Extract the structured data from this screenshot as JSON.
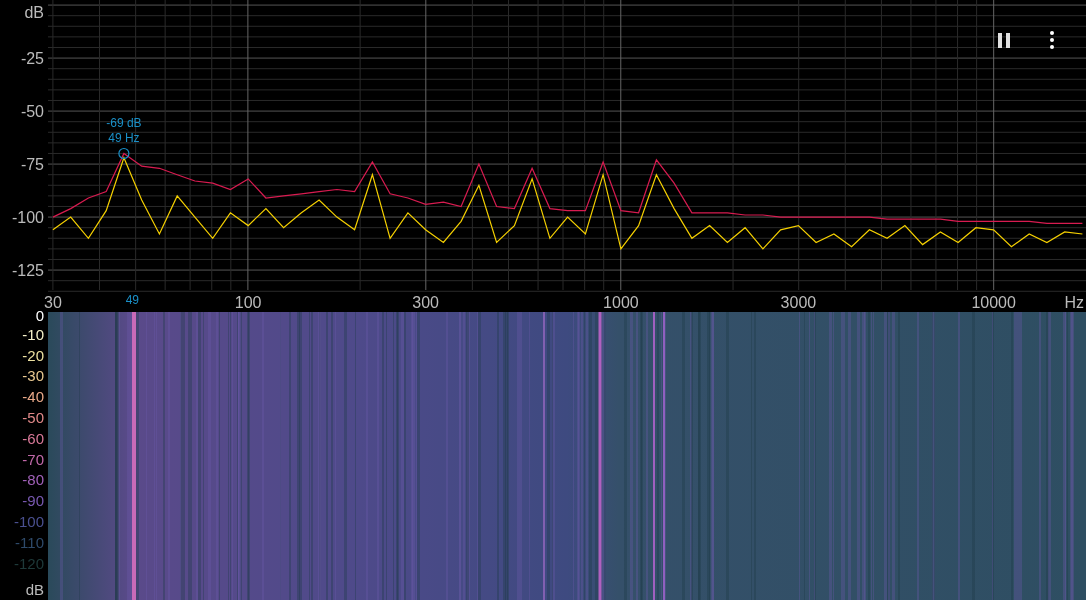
{
  "spectrum": {
    "chart_data": {
      "type": "line",
      "xlabel": "Hz",
      "ylabel": "dB",
      "grid": true,
      "ylim": [
        -134.4,
        2.4
      ],
      "yticks": [
        -25,
        -50,
        -75,
        -100,
        -125
      ],
      "categories": [
        "30",
        null,
        null,
        null,
        null,
        null,
        null,
        null,
        null,
        null,
        null,
        "100",
        null,
        null,
        null,
        null,
        null,
        null,
        null,
        null,
        null,
        "300",
        null,
        null,
        null,
        null,
        null,
        null,
        null,
        null,
        null,
        null,
        "1000",
        null,
        null,
        null,
        null,
        null,
        null,
        null,
        null,
        null,
        "3000",
        null,
        null,
        null,
        null,
        null,
        null,
        null,
        null,
        null,
        null,
        "10000",
        null,
        null,
        null,
        null,
        null
      ],
      "series": [
        {
          "color": "#f5d000",
          "values": [
            -106,
            -100,
            -110,
            -97,
            -72,
            -92,
            -108,
            -90,
            -100,
            -110,
            -98,
            -104,
            -96,
            -105,
            -98,
            -92,
            -100,
            -106,
            -80,
            -110,
            -98,
            -106,
            -112,
            -102,
            -85,
            -112,
            -104,
            -82,
            -110,
            -100,
            -108,
            -80,
            -115,
            -104,
            -80,
            -96,
            -110,
            -104,
            -112,
            -105,
            -115,
            -106,
            -104,
            -112,
            -108,
            -114,
            -106,
            -110,
            -104,
            -113,
            -107,
            -112,
            -105,
            -106,
            -114,
            -108,
            -112,
            -107,
            -108
          ]
        },
        {
          "color": "#d81b50",
          "values": [
            -100,
            -96,
            -91,
            -88,
            -70,
            -76,
            -77,
            -80,
            -83,
            -84,
            -87,
            -82,
            -91,
            -90,
            -89,
            -88,
            -87,
            -88,
            -74,
            -89,
            -91,
            -94,
            -93,
            -95,
            -75,
            -95,
            -96,
            -77,
            -96,
            -97,
            -97,
            -74,
            -97,
            -98,
            -73,
            -84,
            -98,
            -98,
            -98,
            -99,
            -99,
            -100,
            -100,
            -100,
            -100,
            -100,
            -100,
            -101,
            -101,
            -101,
            -101,
            -102,
            -102,
            -102,
            -102,
            -102,
            -103,
            -103,
            -103
          ]
        }
      ]
    },
    "peak_marker": {
      "level_text": "-69 dB",
      "frequency_text": "49 Hz",
      "axis_label": "49"
    }
  },
  "spectrogram": {
    "scale": [
      {
        "label": "0",
        "color": "#ffffff"
      },
      {
        "label": "-10",
        "color": "#f4f0c8"
      },
      {
        "label": "-20",
        "color": "#ece0a0"
      },
      {
        "label": "-30",
        "color": "#e8c890"
      },
      {
        "label": "-40",
        "color": "#e8a888"
      },
      {
        "label": "-50",
        "color": "#e08888"
      },
      {
        "label": "-60",
        "color": "#d87898"
      },
      {
        "label": "-70",
        "color": "#c068a8"
      },
      {
        "label": "-80",
        "color": "#a060b8"
      },
      {
        "label": "-90",
        "color": "#7858b0"
      },
      {
        "label": "-100",
        "color": "#4a5090"
      },
      {
        "label": "-110",
        "color": "#2e4a6a"
      },
      {
        "label": "-120",
        "color": "#1e3a3a"
      }
    ],
    "unit": "dB"
  }
}
